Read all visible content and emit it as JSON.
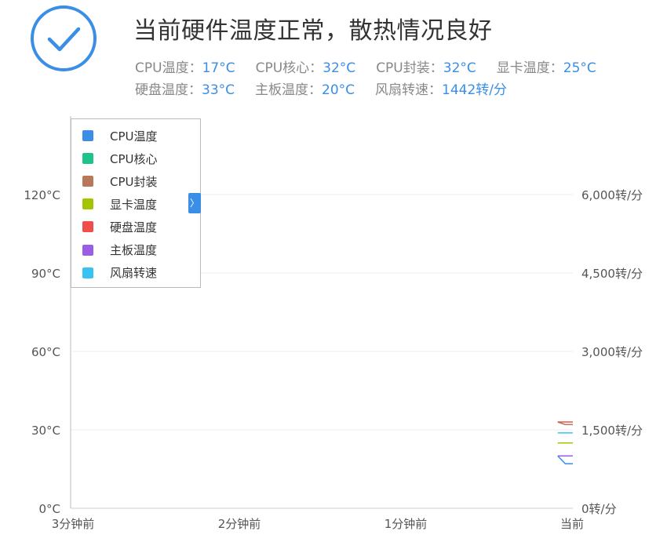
{
  "status": {
    "icon": "check-circle-icon",
    "headline": "当前硬件温度正常，散热情况良好"
  },
  "stats": [
    {
      "label": "CPU温度：",
      "value": "17°C"
    },
    {
      "label": "CPU核心：",
      "value": "32°C"
    },
    {
      "label": "CPU封装：",
      "value": "32°C"
    },
    {
      "label": "显卡温度：",
      "value": "25°C"
    },
    {
      "label": "硬盘温度：",
      "value": "33°C"
    },
    {
      "label": "主板温度：",
      "value": "20°C"
    },
    {
      "label": "风扇转速：",
      "value": "1442转/分"
    }
  ],
  "legend_toggle_icon": "chevron-right-icon",
  "chart_data": {
    "type": "line",
    "x": [
      "3分钟前",
      "2分钟前",
      "1分钟前",
      "当前"
    ],
    "y_left": {
      "ticks": [
        "0°C",
        "30°C",
        "60°C",
        "90°C",
        "120°C"
      ],
      "range": [
        0,
        120
      ],
      "unit": "°C"
    },
    "y_right": {
      "ticks": [
        "0转/分",
        "1,500转/分",
        "3,000转/分",
        "4,500转/分",
        "6,000转/分"
      ],
      "range": [
        0,
        6000
      ],
      "unit": "转/分"
    },
    "grid": true,
    "legend_placement": "top-left",
    "series": [
      {
        "name": "CPU温度",
        "color": "#3a8ee6",
        "axis": "left",
        "points": [
          [
            0.97,
            20
          ],
          [
            0.985,
            17
          ],
          [
            1.0,
            17
          ]
        ]
      },
      {
        "name": "CPU核心",
        "color": "#1ec28b",
        "axis": "left",
        "points": [
          [
            0.97,
            33
          ],
          [
            0.985,
            32
          ],
          [
            1.0,
            32
          ]
        ]
      },
      {
        "name": "CPU封装",
        "color": "#b9785a",
        "axis": "left",
        "points": [
          [
            0.97,
            33
          ],
          [
            0.985,
            32
          ],
          [
            1.0,
            32
          ]
        ]
      },
      {
        "name": "显卡温度",
        "color": "#a5c400",
        "axis": "left",
        "points": [
          [
            0.97,
            25
          ],
          [
            1.0,
            25
          ]
        ]
      },
      {
        "name": "硬盘温度",
        "color": "#f04d4d",
        "axis": "left",
        "points": [
          [
            0.97,
            33
          ],
          [
            0.985,
            33
          ],
          [
            1.0,
            33
          ]
        ]
      },
      {
        "name": "主板温度",
        "color": "#9b5de5",
        "axis": "left",
        "points": [
          [
            0.97,
            20
          ],
          [
            0.975,
            20
          ],
          [
            1.0,
            20
          ]
        ]
      },
      {
        "name": "风扇转速",
        "color": "#38c4f0",
        "axis": "right",
        "points": [
          [
            0.97,
            1442
          ],
          [
            1.0,
            1442
          ]
        ]
      }
    ]
  }
}
